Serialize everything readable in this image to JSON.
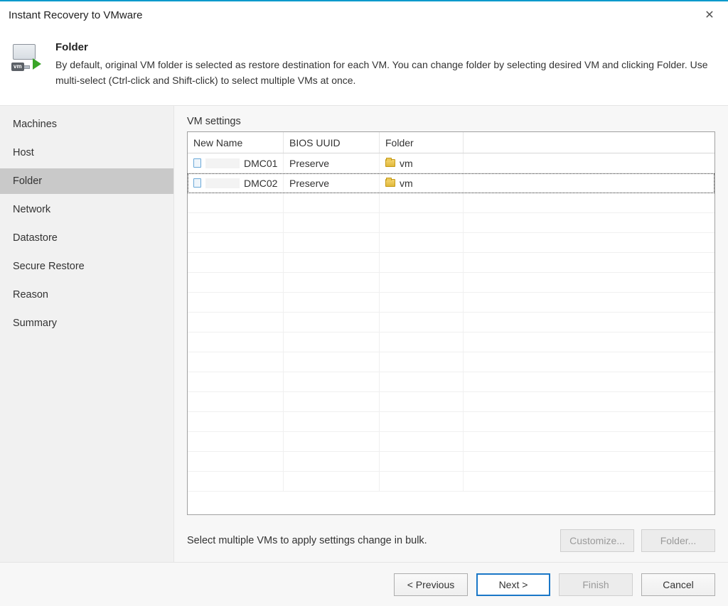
{
  "window": {
    "title": "Instant Recovery to VMware"
  },
  "header": {
    "title": "Folder",
    "description": "By default, original VM folder is selected as restore destination for each VM. You can change folder by selecting desired VM and clicking Folder. Use multi-select (Ctrl-click and Shift-click) to select multiple VMs at once."
  },
  "sidebar": {
    "items": [
      {
        "label": "Machines"
      },
      {
        "label": "Host"
      },
      {
        "label": "Folder"
      },
      {
        "label": "Network"
      },
      {
        "label": "Datastore"
      },
      {
        "label": "Secure Restore"
      },
      {
        "label": "Reason"
      },
      {
        "label": "Summary"
      }
    ],
    "active_index": 2
  },
  "main": {
    "section_label": "VM settings",
    "columns": [
      "New Name",
      "BIOS UUID",
      "Folder"
    ],
    "rows": [
      {
        "name_suffix": "DMC01",
        "bios_uuid": "Preserve",
        "folder": "vm",
        "selected": false
      },
      {
        "name_suffix": "DMC02",
        "bios_uuid": "Preserve",
        "folder": "vm",
        "selected": true
      }
    ],
    "hint": "Select multiple VMs to apply settings change in bulk.",
    "buttons": {
      "customize": "Customize...",
      "folder": "Folder..."
    }
  },
  "footer": {
    "previous": "< Previous",
    "next": "Next >",
    "finish": "Finish",
    "cancel": "Cancel"
  }
}
